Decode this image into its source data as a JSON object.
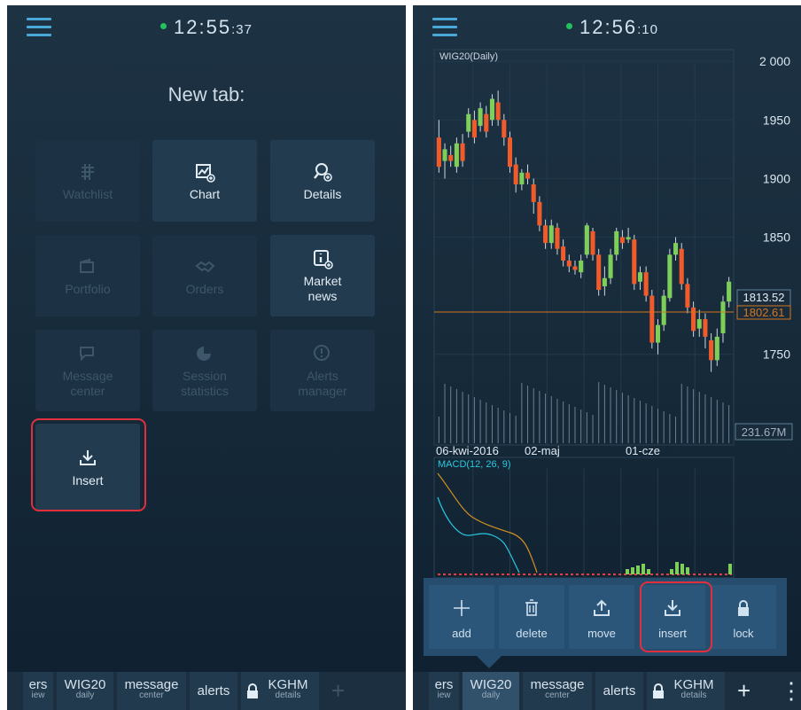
{
  "left": {
    "clock_main": "12:55",
    "clock_sec": ":37",
    "title": "New tab:",
    "tiles": [
      {
        "label": "Watchlist",
        "label2": ""
      },
      {
        "label": "Chart",
        "label2": ""
      },
      {
        "label": "Details",
        "label2": ""
      },
      {
        "label": "Portfolio",
        "label2": ""
      },
      {
        "label": "Orders",
        "label2": ""
      },
      {
        "label": "Market",
        "label2": "news"
      },
      {
        "label": "Message",
        "label2": "center"
      },
      {
        "label": "Session",
        "label2": "statistics"
      },
      {
        "label": "Alerts",
        "label2": "manager"
      },
      {
        "label": "Insert",
        "label2": ""
      }
    ],
    "tabs": [
      {
        "main": "ers",
        "sub": "iew"
      },
      {
        "main": "WIG20",
        "sub": "daily"
      },
      {
        "main": "message",
        "sub": "center"
      },
      {
        "main": "alerts",
        "sub": ""
      },
      {
        "main": "KGHM",
        "sub": "details"
      }
    ],
    "plus": "+"
  },
  "right": {
    "clock_main": "12:56",
    "clock_sec": ":10",
    "chart_title": "WIG20(Daily)",
    "macd_title": "MACD(12, 26, 9)",
    "dates": [
      "06-kwi-2016",
      "02-maj",
      "01-cze"
    ],
    "price_last": "1813.52",
    "price_ref": "1802.61",
    "volume_label": "231.67M",
    "popup": [
      {
        "label": "add"
      },
      {
        "label": "delete"
      },
      {
        "label": "move"
      },
      {
        "label": "insert"
      },
      {
        "label": "lock"
      }
    ],
    "tabs": [
      {
        "main": "ers",
        "sub": "iew"
      },
      {
        "main": "WIG20",
        "sub": "daily"
      },
      {
        "main": "message",
        "sub": "center"
      },
      {
        "main": "alerts",
        "sub": ""
      },
      {
        "main": "KGHM",
        "sub": "details"
      }
    ],
    "plus": "+",
    "more": "⋮"
  },
  "chart_data": {
    "type": "candlestick",
    "title": "WIG20(Daily)",
    "y_ticks": [
      2000,
      1950,
      1900,
      1850,
      1750
    ],
    "ylim": [
      1715,
      2010
    ],
    "x_labels": [
      "06-kwi-2016",
      "02-maj",
      "01-cze"
    ],
    "candles": [
      {
        "o": 1935,
        "c": 1910,
        "h": 1950,
        "l": 1905
      },
      {
        "o": 1915,
        "c": 1925,
        "h": 1930,
        "l": 1900
      },
      {
        "o": 1920,
        "c": 1915,
        "h": 1928,
        "l": 1910
      },
      {
        "o": 1910,
        "c": 1930,
        "h": 1935,
        "l": 1905
      },
      {
        "o": 1930,
        "c": 1915,
        "h": 1938,
        "l": 1910
      },
      {
        "o": 1940,
        "c": 1955,
        "h": 1960,
        "l": 1935
      },
      {
        "o": 1950,
        "c": 1935,
        "h": 1958,
        "l": 1930
      },
      {
        "o": 1945,
        "c": 1960,
        "h": 1965,
        "l": 1940
      },
      {
        "o": 1955,
        "c": 1940,
        "h": 1962,
        "l": 1935
      },
      {
        "o": 1950,
        "c": 1968,
        "h": 1972,
        "l": 1945
      },
      {
        "o": 1965,
        "c": 1950,
        "h": 1975,
        "l": 1945
      },
      {
        "o": 1950,
        "c": 1935,
        "h": 1955,
        "l": 1928
      },
      {
        "o": 1935,
        "c": 1910,
        "h": 1940,
        "l": 1905
      },
      {
        "o": 1912,
        "c": 1895,
        "h": 1918,
        "l": 1888
      },
      {
        "o": 1895,
        "c": 1905,
        "h": 1908,
        "l": 1890
      },
      {
        "o": 1905,
        "c": 1900,
        "h": 1912,
        "l": 1895
      },
      {
        "o": 1895,
        "c": 1880,
        "h": 1900,
        "l": 1870
      },
      {
        "o": 1880,
        "c": 1860,
        "h": 1885,
        "l": 1855
      },
      {
        "o": 1860,
        "c": 1845,
        "h": 1865,
        "l": 1840
      },
      {
        "o": 1845,
        "c": 1860,
        "h": 1865,
        "l": 1840
      },
      {
        "o": 1858,
        "c": 1840,
        "h": 1862,
        "l": 1835
      },
      {
        "o": 1842,
        "c": 1830,
        "h": 1848,
        "l": 1825
      },
      {
        "o": 1830,
        "c": 1825,
        "h": 1835,
        "l": 1820
      },
      {
        "o": 1825,
        "c": 1822,
        "h": 1830,
        "l": 1818
      },
      {
        "o": 1820,
        "c": 1830,
        "h": 1835,
        "l": 1815
      },
      {
        "o": 1835,
        "c": 1860,
        "h": 1862,
        "l": 1832
      },
      {
        "o": 1855,
        "c": 1835,
        "h": 1858,
        "l": 1830
      },
      {
        "o": 1835,
        "c": 1805,
        "h": 1840,
        "l": 1800
      },
      {
        "o": 1808,
        "c": 1815,
        "h": 1825,
        "l": 1800
      },
      {
        "o": 1815,
        "c": 1835,
        "h": 1840,
        "l": 1810
      },
      {
        "o": 1835,
        "c": 1855,
        "h": 1858,
        "l": 1830
      },
      {
        "o": 1850,
        "c": 1845,
        "h": 1856,
        "l": 1840
      },
      {
        "o": 1848,
        "c": 1850,
        "h": 1858,
        "l": 1845
      },
      {
        "o": 1848,
        "c": 1810,
        "h": 1852,
        "l": 1805
      },
      {
        "o": 1812,
        "c": 1820,
        "h": 1825,
        "l": 1805
      },
      {
        "o": 1820,
        "c": 1800,
        "h": 1825,
        "l": 1795
      },
      {
        "o": 1800,
        "c": 1760,
        "h": 1805,
        "l": 1755
      },
      {
        "o": 1760,
        "c": 1775,
        "h": 1780,
        "l": 1750
      },
      {
        "o": 1775,
        "c": 1800,
        "h": 1805,
        "l": 1770
      },
      {
        "o": 1798,
        "c": 1835,
        "h": 1840,
        "l": 1795
      },
      {
        "o": 1835,
        "c": 1845,
        "h": 1850,
        "l": 1830
      },
      {
        "o": 1840,
        "c": 1810,
        "h": 1845,
        "l": 1805
      },
      {
        "o": 1810,
        "c": 1790,
        "h": 1815,
        "l": 1785
      },
      {
        "o": 1790,
        "c": 1770,
        "h": 1795,
        "l": 1765
      },
      {
        "o": 1772,
        "c": 1780,
        "h": 1788,
        "l": 1765
      },
      {
        "o": 1780,
        "c": 1765,
        "h": 1785,
        "l": 1755
      },
      {
        "o": 1762,
        "c": 1745,
        "h": 1768,
        "l": 1735
      },
      {
        "o": 1745,
        "c": 1765,
        "h": 1772,
        "l": 1740
      },
      {
        "o": 1768,
        "c": 1795,
        "h": 1800,
        "l": 1760
      },
      {
        "o": 1795,
        "c": 1812,
        "h": 1816,
        "l": 1790
      }
    ]
  }
}
